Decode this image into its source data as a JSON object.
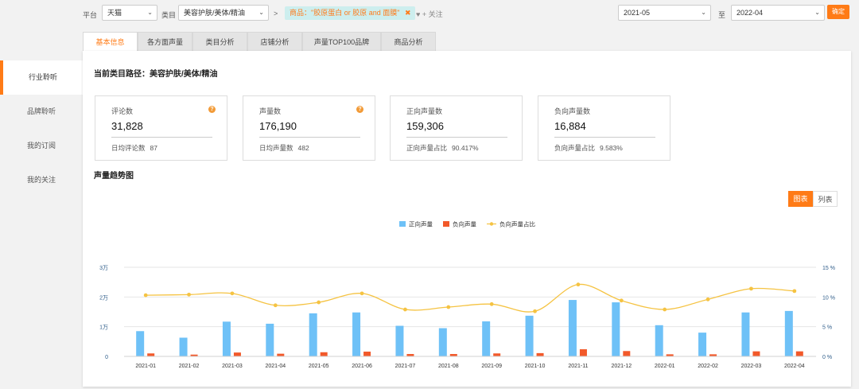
{
  "filters": {
    "platform_label": "平台",
    "platform_value": "天猫",
    "category_label": "类目",
    "category_value": "美容护肤/美体/精油",
    "separator": ">",
    "product_tag": "商品：\"胶原蛋白 or 胶原 and 面膜\"",
    "tag_close": "✖",
    "follow_label": "♥ + 关注",
    "date_start": "2021-05",
    "date_to_label": "至",
    "date_end": "2022-04",
    "confirm_label": "确定"
  },
  "sidebar": {
    "items": [
      {
        "label": "行业聆听",
        "active": true
      },
      {
        "label": "品牌聆听",
        "active": false
      },
      {
        "label": "我的订阅",
        "active": false
      },
      {
        "label": "我的关注",
        "active": false
      }
    ]
  },
  "tabs": [
    {
      "label": "基本信息",
      "active": true
    },
    {
      "label": "各方面声量",
      "active": false
    },
    {
      "label": "类目分析",
      "active": false
    },
    {
      "label": "店铺分析",
      "active": false
    },
    {
      "label": "声量TOP100品牌",
      "active": false
    },
    {
      "label": "商品分析",
      "active": false
    }
  ],
  "main": {
    "category_path": "当前类目路径：美容护肤/美体/精油",
    "cards": [
      {
        "title": "评论数",
        "value": "31,828",
        "sub_label": "日均评论数",
        "sub_value": "87",
        "help": true
      },
      {
        "title": "声量数",
        "value": "176,190",
        "sub_label": "日均声量数",
        "sub_value": "482",
        "help": true
      },
      {
        "title": "正向声量数",
        "value": "159,306",
        "sub_label": "正向声量占比",
        "sub_value": "90.417%",
        "help": false
      },
      {
        "title": "负向声量数",
        "value": "16,884",
        "sub_label": "负向声量占比",
        "sub_value": "9.583%",
        "help": false
      }
    ],
    "trend_title": "声量趋势图",
    "view_chart": "图表",
    "view_list": "列表",
    "help_icon": "?"
  },
  "colors": {
    "accent": "#ff7b16",
    "positive": "#6ec1f7",
    "negative": "#f2592a",
    "ratio_line": "#f5c342"
  },
  "chart_data": {
    "type": "bar",
    "categories": [
      "2021-01",
      "2021-02",
      "2021-03",
      "2021-04",
      "2021-05",
      "2021-06",
      "2021-07",
      "2021-08",
      "2021-09",
      "2021-10",
      "2021-11",
      "2021-12",
      "2022-01",
      "2022-02",
      "2022-03",
      "2022-04"
    ],
    "series": [
      {
        "name": "正向声量",
        "type": "bar",
        "axis": "left",
        "values": [
          8500,
          6300,
          11700,
          11000,
          14500,
          14800,
          10300,
          9500,
          11800,
          13700,
          19000,
          18200,
          10500,
          8000,
          14800,
          15300
        ]
      },
      {
        "name": "负向声量",
        "type": "bar",
        "axis": "left",
        "values": [
          1000,
          600,
          1300,
          900,
          1400,
          1600,
          800,
          800,
          1000,
          1100,
          2400,
          1800,
          700,
          700,
          1700,
          1700
        ]
      },
      {
        "name": "负向声量占比",
        "type": "line",
        "axis": "right",
        "values": [
          10.3,
          10.4,
          10.6,
          8.6,
          9.1,
          10.6,
          7.9,
          8.3,
          8.8,
          7.6,
          12.1,
          9.4,
          7.9,
          9.6,
          11.4,
          11.0
        ]
      }
    ],
    "left_axis": {
      "ticks": [
        "0",
        "1万",
        "2万",
        "3万"
      ],
      "ylim": [
        0,
        30000
      ]
    },
    "right_axis": {
      "ticks": [
        "0 %",
        "5 %",
        "10 %",
        "15 %"
      ],
      "ylim": [
        0,
        15
      ]
    },
    "legend_position": "top-center",
    "grid": true
  }
}
